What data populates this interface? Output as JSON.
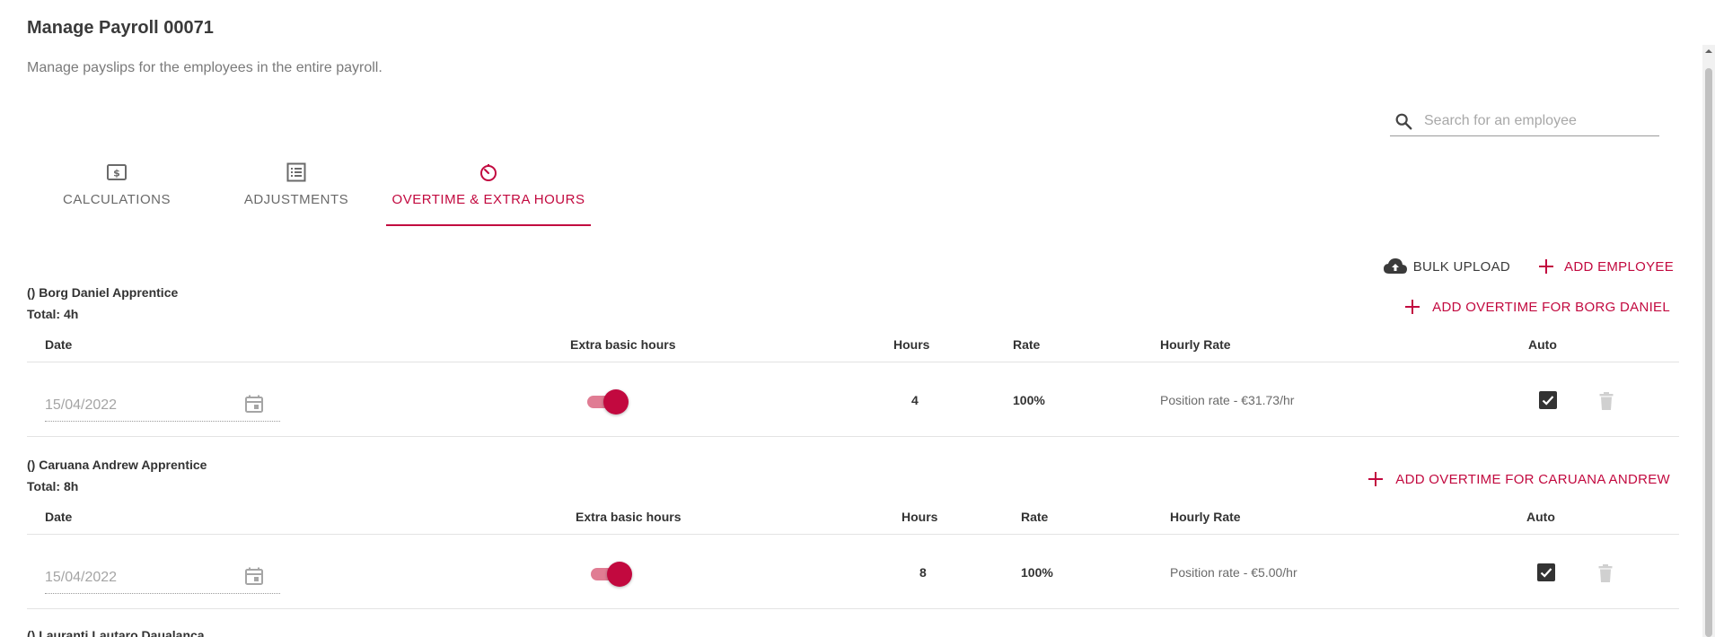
{
  "page": {
    "title": "Manage Payroll 00071",
    "subtitle": "Manage payslips for the employees in the entire payroll."
  },
  "search": {
    "placeholder": "Search for an employee",
    "icon": "search-icon"
  },
  "tabs": [
    {
      "label": "CALCULATIONS",
      "icon": "dollar-bill-icon",
      "active": false
    },
    {
      "label": "ADJUSTMENTS",
      "icon": "list-icon",
      "active": false
    },
    {
      "label": "OVERTIME & EXTRA HOURS",
      "icon": "timer-icon",
      "active": true
    }
  ],
  "actions": {
    "bulk_upload": "BULK UPLOAD",
    "add_employee": "ADD EMPLOYEE"
  },
  "columns": {
    "date": "Date",
    "extra_basic_hours": "Extra basic hours",
    "hours": "Hours",
    "rate": "Rate",
    "hourly_rate": "Hourly Rate",
    "auto": "Auto"
  },
  "employees": [
    {
      "name": "() Borg Daniel Apprentice",
      "total": "Total: 4h",
      "add_label": "ADD OVERTIME FOR BORG DANIEL",
      "rows": [
        {
          "date": "15/04/2022",
          "extra_basic_hours": true,
          "hours": "4",
          "rate": "100%",
          "hourly_rate": "Position rate - €31.73/hr",
          "auto": true
        }
      ]
    },
    {
      "name": "() Caruana Andrew Apprentice",
      "total": "Total: 8h",
      "add_label": "ADD OVERTIME FOR CARUANA ANDREW",
      "rows": [
        {
          "date": "15/04/2022",
          "extra_basic_hours": true,
          "hours": "8",
          "rate": "100%",
          "hourly_rate": "Position rate - €5.00/hr",
          "auto": true
        }
      ]
    },
    {
      "name": "() Lauranti Lautaro Daualanca"
    }
  ],
  "colors": {
    "accent": "#c2093f",
    "toggle_track": "#e07c93",
    "text": "#333333",
    "muted": "#7a7a7a"
  }
}
